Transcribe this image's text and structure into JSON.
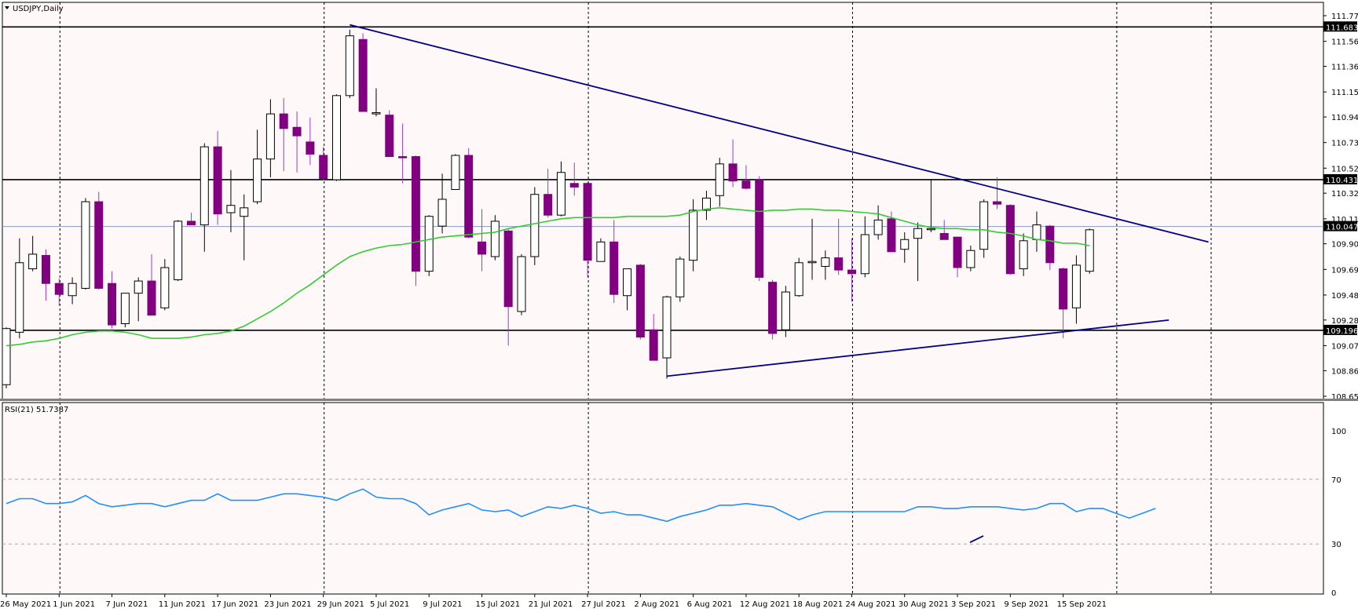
{
  "window": {
    "symbol_title": "USDJPY,Daily"
  },
  "colors": {
    "background": "#fff8f8",
    "bull_body": "#ffffff",
    "bear_body": "#800080",
    "bull_wick": "#000000",
    "bear_wick": "#9c3bc7",
    "ma_line": "#32cd32",
    "trendline": "#00008b",
    "rsi_line": "#1e90ff",
    "level_line": "#000000",
    "current_price_line": "#8a9bc0"
  },
  "chart_data": [
    {
      "type": "candlestick",
      "title": "USDJPY,Daily",
      "ylim": [
        108.655,
        111.775
      ],
      "yticks": [
        "111.775",
        "111.565",
        "111.360",
        "111.150",
        "110.945",
        "110.735",
        "110.525",
        "110.320",
        "110.110",
        "109.905",
        "109.695",
        "109.485",
        "109.280",
        "109.070",
        "108.865",
        "108.655"
      ],
      "xticks": [
        {
          "i": 0,
          "label": "26 May 2021"
        },
        {
          "i": 4,
          "label": "1 Jun 2021"
        },
        {
          "i": 8,
          "label": "7 Jun 2021"
        },
        {
          "i": 12,
          "label": "11 Jun 2021"
        },
        {
          "i": 16,
          "label": "17 Jun 2021"
        },
        {
          "i": 20,
          "label": "23 Jun 2021"
        },
        {
          "i": 24,
          "label": "29 Jun 2021"
        },
        {
          "i": 28,
          "label": "5 Jul 2021"
        },
        {
          "i": 32,
          "label": "9 Jul 2021"
        },
        {
          "i": 36,
          "label": "15 Jul 2021"
        },
        {
          "i": 40,
          "label": "21 Jul 2021"
        },
        {
          "i": 44,
          "label": "27 Jul 2021"
        },
        {
          "i": 48,
          "label": "2 Aug 2021"
        },
        {
          "i": 52,
          "label": "6 Aug 2021"
        },
        {
          "i": 56,
          "label": "12 Aug 2021"
        },
        {
          "i": 60,
          "label": "18 Aug 2021"
        },
        {
          "i": 64,
          "label": "24 Aug 2021"
        },
        {
          "i": 68,
          "label": "30 Aug 2021"
        },
        {
          "i": 72,
          "label": "3 Sep 2021"
        },
        {
          "i": 76,
          "label": "9 Sep 2021"
        },
        {
          "i": 80,
          "label": "15 Sep 2021"
        }
      ],
      "candles": [
        {
          "o": 108.75,
          "h": 109.22,
          "l": 108.72,
          "c": 109.21
        },
        {
          "o": 109.18,
          "h": 109.95,
          "l": 109.13,
          "c": 109.75
        },
        {
          "o": 109.7,
          "h": 109.97,
          "l": 109.68,
          "c": 109.82
        },
        {
          "o": 109.81,
          "h": 109.86,
          "l": 109.44,
          "c": 109.58
        },
        {
          "o": 109.58,
          "h": 109.62,
          "l": 109.4,
          "c": 109.49
        },
        {
          "o": 109.48,
          "h": 109.63,
          "l": 109.41,
          "c": 109.58
        },
        {
          "o": 109.54,
          "h": 110.28,
          "l": 109.53,
          "c": 110.25
        },
        {
          "o": 110.25,
          "h": 110.33,
          "l": 109.53,
          "c": 109.54
        },
        {
          "o": 109.58,
          "h": 109.68,
          "l": 109.21,
          "c": 109.24
        },
        {
          "o": 109.25,
          "h": 109.5,
          "l": 109.22,
          "c": 109.5
        },
        {
          "o": 109.5,
          "h": 109.63,
          "l": 109.27,
          "c": 109.6
        },
        {
          "o": 109.6,
          "h": 109.82,
          "l": 109.32,
          "c": 109.32
        },
        {
          "o": 109.38,
          "h": 109.78,
          "l": 109.36,
          "c": 109.71
        },
        {
          "o": 109.61,
          "h": 110.1,
          "l": 109.6,
          "c": 110.09
        },
        {
          "o": 110.09,
          "h": 110.16,
          "l": 110.06,
          "c": 110.06
        },
        {
          "o": 110.06,
          "h": 110.73,
          "l": 109.84,
          "c": 110.7
        },
        {
          "o": 110.7,
          "h": 110.83,
          "l": 110.06,
          "c": 110.15
        },
        {
          "o": 110.16,
          "h": 110.51,
          "l": 110.0,
          "c": 110.22
        },
        {
          "o": 110.13,
          "h": 110.31,
          "l": 109.77,
          "c": 110.2
        },
        {
          "o": 110.25,
          "h": 110.84,
          "l": 110.23,
          "c": 110.6
        },
        {
          "o": 110.6,
          "h": 111.09,
          "l": 110.45,
          "c": 110.97
        },
        {
          "o": 110.97,
          "h": 111.1,
          "l": 110.5,
          "c": 110.85
        },
        {
          "o": 110.86,
          "h": 110.99,
          "l": 110.49,
          "c": 110.79
        },
        {
          "o": 110.74,
          "h": 110.94,
          "l": 110.55,
          "c": 110.64
        },
        {
          "o": 110.63,
          "h": 110.7,
          "l": 110.43,
          "c": 110.44
        },
        {
          "o": 110.43,
          "h": 111.13,
          "l": 110.42,
          "c": 111.12
        },
        {
          "o": 111.12,
          "h": 111.66,
          "l": 111.1,
          "c": 111.61
        },
        {
          "o": 111.58,
          "h": 111.63,
          "l": 110.99,
          "c": 110.99
        },
        {
          "o": 110.97,
          "h": 111.18,
          "l": 110.95,
          "c": 110.98
        },
        {
          "o": 110.96,
          "h": 111.0,
          "l": 110.62,
          "c": 110.62
        },
        {
          "o": 110.62,
          "h": 110.89,
          "l": 110.4,
          "c": 110.61
        },
        {
          "o": 110.62,
          "h": 110.63,
          "l": 109.56,
          "c": 109.68
        },
        {
          "o": 109.68,
          "h": 110.14,
          "l": 109.64,
          "c": 110.13
        },
        {
          "o": 110.05,
          "h": 110.48,
          "l": 109.99,
          "c": 110.27
        },
        {
          "o": 110.35,
          "h": 110.64,
          "l": 110.35,
          "c": 110.63
        },
        {
          "o": 110.63,
          "h": 110.69,
          "l": 109.95,
          "c": 109.96
        },
        {
          "o": 109.92,
          "h": 110.19,
          "l": 109.68,
          "c": 109.82
        },
        {
          "o": 109.8,
          "h": 110.14,
          "l": 109.77,
          "c": 110.09
        },
        {
          "o": 110.01,
          "h": 110.03,
          "l": 109.07,
          "c": 109.39
        },
        {
          "o": 109.35,
          "h": 109.82,
          "l": 109.32,
          "c": 109.8
        },
        {
          "o": 109.8,
          "h": 110.37,
          "l": 109.73,
          "c": 110.31
        },
        {
          "o": 110.31,
          "h": 110.52,
          "l": 110.12,
          "c": 110.14
        },
        {
          "o": 110.14,
          "h": 110.58,
          "l": 110.13,
          "c": 110.49
        },
        {
          "o": 110.4,
          "h": 110.57,
          "l": 110.3,
          "c": 110.37
        },
        {
          "o": 110.4,
          "h": 110.41,
          "l": 109.63,
          "c": 109.77
        },
        {
          "o": 109.76,
          "h": 109.95,
          "l": 109.76,
          "c": 109.92
        },
        {
          "o": 109.92,
          "h": 110.1,
          "l": 109.42,
          "c": 109.49
        },
        {
          "o": 109.48,
          "h": 109.7,
          "l": 109.36,
          "c": 109.7
        },
        {
          "o": 109.73,
          "h": 109.74,
          "l": 109.12,
          "c": 109.14
        },
        {
          "o": 109.2,
          "h": 109.33,
          "l": 108.95,
          "c": 108.95
        },
        {
          "o": 108.97,
          "h": 109.48,
          "l": 108.8,
          "c": 109.47
        },
        {
          "o": 109.47,
          "h": 109.8,
          "l": 109.43,
          "c": 109.78
        },
        {
          "o": 109.77,
          "h": 110.27,
          "l": 109.68,
          "c": 110.18
        },
        {
          "o": 110.18,
          "h": 110.34,
          "l": 110.1,
          "c": 110.28
        },
        {
          "o": 110.3,
          "h": 110.61,
          "l": 110.21,
          "c": 110.56
        },
        {
          "o": 110.56,
          "h": 110.76,
          "l": 110.37,
          "c": 110.42
        },
        {
          "o": 110.42,
          "h": 110.55,
          "l": 110.35,
          "c": 110.36
        },
        {
          "o": 110.43,
          "h": 110.46,
          "l": 109.6,
          "c": 109.63
        },
        {
          "o": 109.59,
          "h": 109.61,
          "l": 109.12,
          "c": 109.17
        },
        {
          "o": 109.2,
          "h": 109.56,
          "l": 109.14,
          "c": 109.51
        },
        {
          "o": 109.48,
          "h": 109.79,
          "l": 109.47,
          "c": 109.75
        },
        {
          "o": 109.75,
          "h": 110.11,
          "l": 109.61,
          "c": 109.76
        },
        {
          "o": 109.72,
          "h": 109.85,
          "l": 109.61,
          "c": 109.79
        },
        {
          "o": 109.79,
          "h": 110.11,
          "l": 109.65,
          "c": 109.69
        },
        {
          "o": 109.69,
          "h": 109.95,
          "l": 109.43,
          "c": 109.66
        },
        {
          "o": 109.66,
          "h": 110.13,
          "l": 109.63,
          "c": 109.98
        },
        {
          "o": 109.98,
          "h": 110.22,
          "l": 109.94,
          "c": 110.1
        },
        {
          "o": 110.11,
          "h": 110.17,
          "l": 109.84,
          "c": 109.84
        },
        {
          "o": 109.86,
          "h": 110.0,
          "l": 109.75,
          "c": 109.94
        },
        {
          "o": 109.95,
          "h": 110.08,
          "l": 109.6,
          "c": 110.03
        },
        {
          "o": 110.03,
          "h": 110.43,
          "l": 110.0,
          "c": 110.03
        },
        {
          "o": 109.99,
          "h": 110.1,
          "l": 109.94,
          "c": 109.94
        },
        {
          "o": 109.96,
          "h": 109.96,
          "l": 109.63,
          "c": 109.71
        },
        {
          "o": 109.71,
          "h": 109.89,
          "l": 109.68,
          "c": 109.85
        },
        {
          "o": 109.86,
          "h": 110.27,
          "l": 109.79,
          "c": 110.25
        },
        {
          "o": 110.25,
          "h": 110.45,
          "l": 110.19,
          "c": 110.23
        },
        {
          "o": 110.22,
          "h": 110.23,
          "l": 109.65,
          "c": 109.66
        },
        {
          "o": 109.7,
          "h": 109.99,
          "l": 109.64,
          "c": 109.93
        },
        {
          "o": 109.94,
          "h": 110.17,
          "l": 109.84,
          "c": 110.06
        },
        {
          "o": 110.05,
          "h": 110.06,
          "l": 109.69,
          "c": 109.75
        },
        {
          "o": 109.7,
          "h": 109.71,
          "l": 109.13,
          "c": 109.37
        },
        {
          "o": 109.38,
          "h": 109.81,
          "l": 109.25,
          "c": 109.73
        },
        {
          "o": 109.68,
          "h": 110.03,
          "l": 109.66,
          "c": 110.02
        }
      ],
      "moving_average": [
        109.07,
        109.08,
        109.1,
        109.11,
        109.13,
        109.16,
        109.18,
        109.19,
        109.19,
        109.18,
        109.16,
        109.13,
        109.13,
        109.13,
        109.14,
        109.16,
        109.17,
        109.19,
        109.23,
        109.29,
        109.35,
        109.42,
        109.5,
        109.57,
        109.65,
        109.73,
        109.8,
        109.84,
        109.87,
        109.89,
        109.9,
        109.92,
        109.94,
        109.96,
        109.97,
        109.98,
        109.99,
        110.0,
        110.03,
        110.05,
        110.07,
        110.09,
        110.11,
        110.12,
        110.12,
        110.12,
        110.12,
        110.13,
        110.13,
        110.13,
        110.13,
        110.14,
        110.17,
        110.19,
        110.2,
        110.19,
        110.18,
        110.17,
        110.18,
        110.18,
        110.19,
        110.19,
        110.18,
        110.18,
        110.17,
        110.16,
        110.15,
        110.12,
        110.09,
        110.06,
        110.04,
        110.03,
        110.03,
        110.02,
        110.02,
        110.0,
        109.99,
        109.97,
        109.94,
        109.93,
        109.91,
        109.91,
        109.89
      ],
      "hlines": [
        {
          "value": 111.683,
          "label": "111.683",
          "color": "#000000"
        },
        {
          "value": 110.431,
          "label": "110.431",
          "color": "#000000"
        },
        {
          "value": 109.196,
          "label": "109.196",
          "color": "#000000"
        },
        {
          "value": 110.047,
          "label": "110.047",
          "color": "#8a9bc0"
        }
      ],
      "trendlines": [
        {
          "from": {
            "i": 26,
            "v": 111.7
          },
          "to": {
            "i": 91,
            "v": 109.92
          }
        },
        {
          "from": {
            "i": 50,
            "v": 108.82
          },
          "to": {
            "i": 88,
            "v": 109.28
          }
        }
      ]
    },
    {
      "type": "line",
      "title": "RSI(21) 51.7387",
      "ylim": [
        0,
        100
      ],
      "yticks": [
        "100",
        "70",
        "30",
        "0"
      ],
      "levels": [
        70,
        30
      ],
      "values": [
        55,
        58,
        58,
        55,
        55,
        56,
        60,
        55,
        53,
        54,
        55,
        55,
        53,
        55,
        57,
        57,
        61,
        57,
        57,
        57,
        59,
        61,
        61,
        60,
        59,
        57,
        61,
        64,
        59,
        58,
        58,
        55,
        48,
        51,
        53,
        55,
        51,
        50,
        51,
        47,
        50,
        53,
        52,
        54,
        52,
        49,
        50,
        48,
        48,
        46,
        44,
        47,
        49,
        51,
        54,
        54,
        55,
        54,
        53,
        49,
        45,
        48,
        50,
        50,
        50,
        50,
        50,
        50,
        50,
        53,
        53,
        52,
        52,
        53,
        53,
        53,
        52,
        51,
        52,
        55,
        55,
        50,
        52,
        52,
        49,
        46,
        49,
        52
      ],
      "trendline": {
        "from": {
          "i": 80,
          "v": 31
        },
        "to": {
          "i": 81,
          "v": 35
        }
      }
    }
  ]
}
